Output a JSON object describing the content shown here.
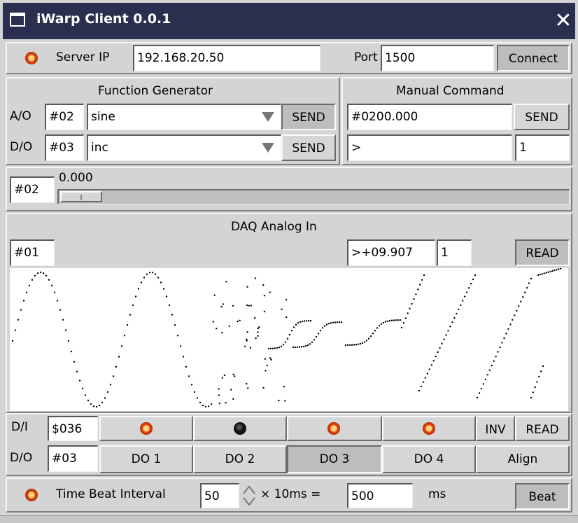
{
  "window": {
    "title": "iWarp Client 0.0.1"
  },
  "server": {
    "ip_label": "Server IP",
    "ip_value": "192.168.20.50",
    "port_label": "Port",
    "port_value": "1500",
    "connect_label": "Connect"
  },
  "function_generator": {
    "title": "Function Generator",
    "rows": [
      {
        "label": "A/O",
        "channel": "#02",
        "waveform": "sine",
        "send_label": "SEND"
      },
      {
        "label": "D/O",
        "channel": "#03",
        "waveform": "inc",
        "send_label": "SEND"
      }
    ]
  },
  "manual_command": {
    "title": "Manual Command",
    "command_value": "#0200.000",
    "send_label": "SEND",
    "response_value": ">",
    "count_value": "1"
  },
  "slider": {
    "channel": "#02",
    "value_text": "0.000",
    "level": 0.0
  },
  "daq": {
    "title": "DAQ Analog In",
    "channel": "#01",
    "reading": ">+09.907",
    "count": "1",
    "read_label": "READ"
  },
  "digital_in": {
    "label": "D/I",
    "value": "$036",
    "leds": [
      "on",
      "off",
      "on",
      "on"
    ],
    "inv_label": "INV",
    "read_label": "READ"
  },
  "digital_out": {
    "label": "D/O",
    "channel": "#03",
    "buttons": [
      "DO 1",
      "DO 2",
      "DO 3",
      "DO 4"
    ],
    "align_label": "Align"
  },
  "beat": {
    "label": "Time Beat Interval",
    "interval": "50",
    "multiplier_text": "× 10ms =",
    "result": "500",
    "unit": "ms",
    "beat_label": "Beat"
  },
  "colors": {
    "titlebar": "#2a2f4f",
    "led_on": "#e8501a",
    "led_off": "#111111"
  }
}
